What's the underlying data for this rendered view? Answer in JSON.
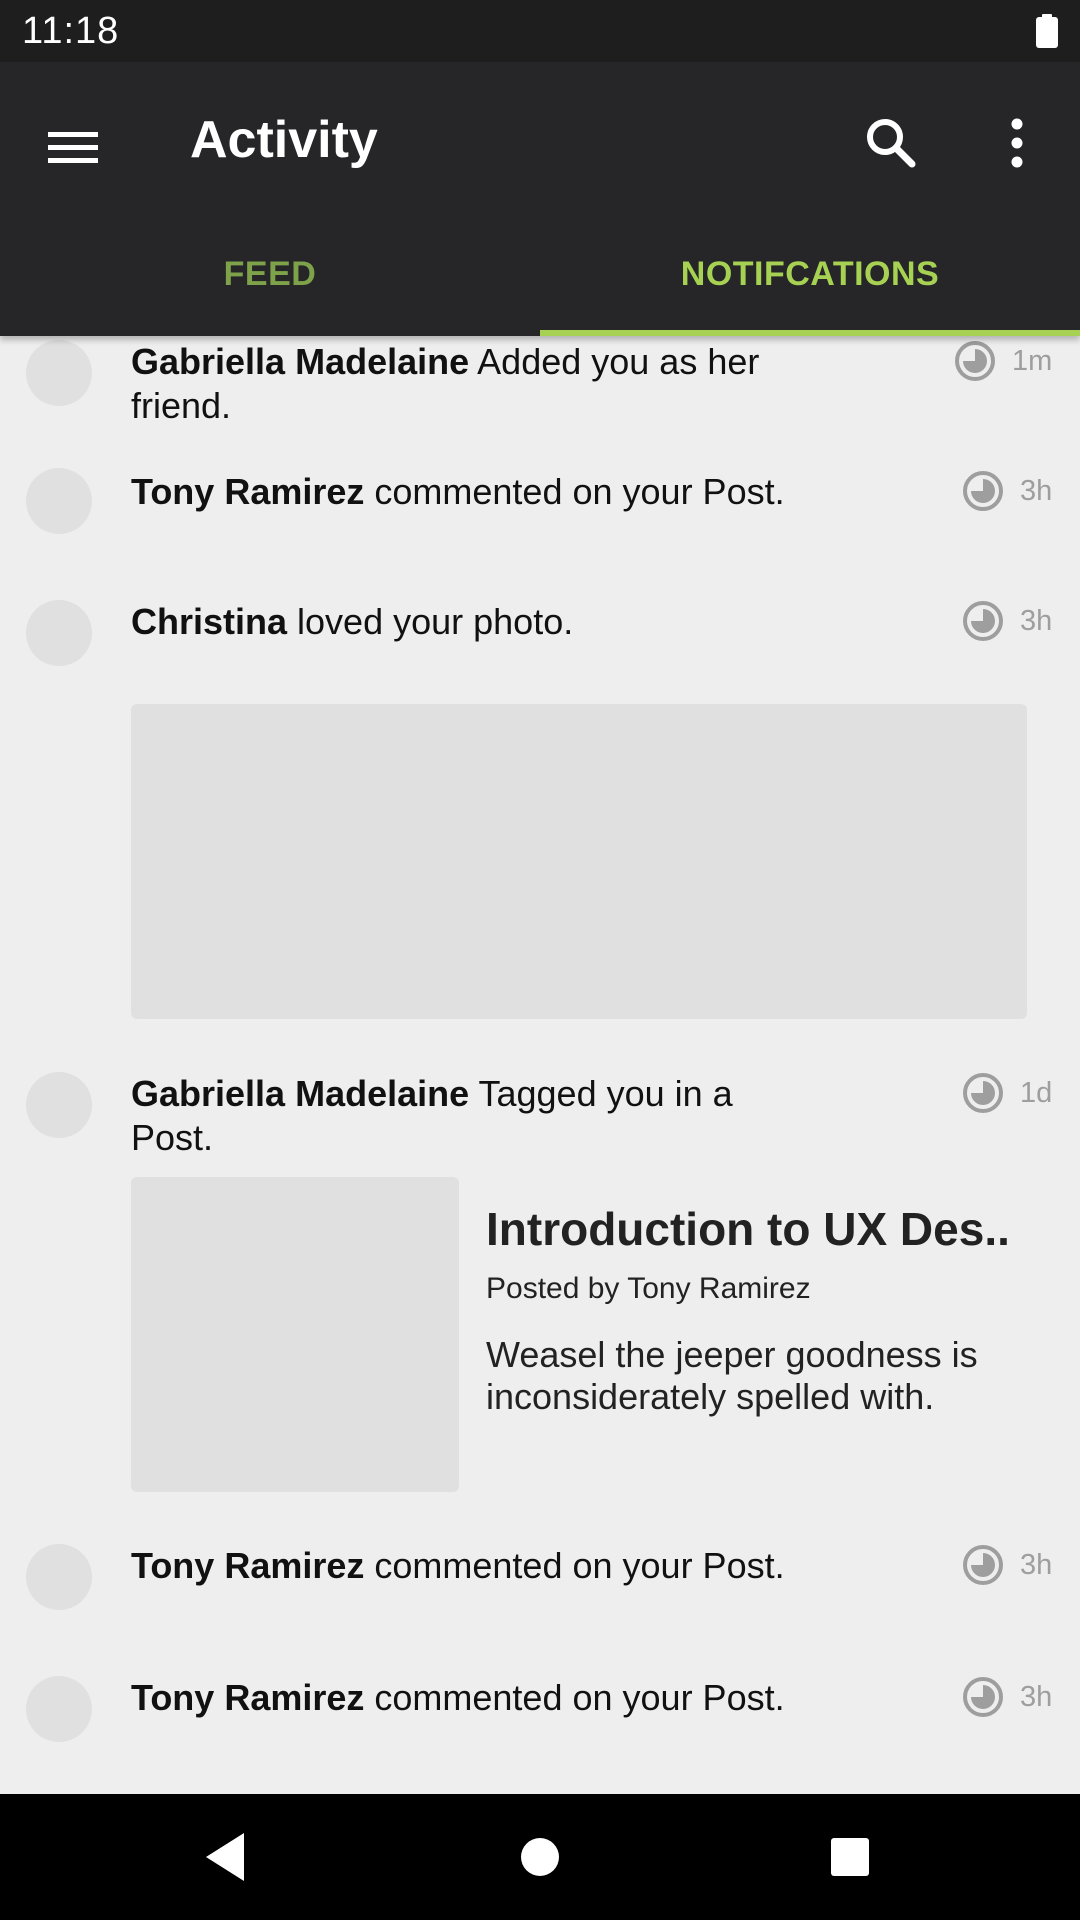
{
  "status_bar": {
    "time": "11:18",
    "battery_icon": "battery-full-icon"
  },
  "app_bar": {
    "title": "Activity",
    "menu_icon": "menu-icon",
    "search_icon": "search-icon",
    "more_icon": "more-vert-icon"
  },
  "tabs": [
    {
      "label": "FEED",
      "selected": false
    },
    {
      "label": "NOTIFCATIONS",
      "selected": true
    }
  ],
  "colors": {
    "accent": "#a7d153",
    "feed_tab": "#7ea24a",
    "app_bar": "#262628",
    "background": "#eeeeee",
    "placeholder": "#e0e0e0",
    "time": "#9e9e9e"
  },
  "notifications": [
    {
      "name": "Gabriella Madelaine",
      "action": " Added you as her",
      "action_line2": "friend.",
      "time": "1m"
    },
    {
      "name": "Tony Ramirez",
      "action": " commented on your Post.",
      "time": "3h"
    },
    {
      "name": "Christina",
      "action": " loved your photo.",
      "time": "3h"
    },
    {
      "name": "Gabriella Madelaine",
      "action": " Tagged you in a",
      "action_line2": "Post.",
      "time": "1d",
      "post": {
        "title": "Introduction to UX Des..",
        "author": "Posted by Tony Ramirez",
        "body": "Weasel the jeeper goodness is inconsiderately spelled with."
      }
    },
    {
      "name": "Tony Ramirez",
      "action": " commented on your Post.",
      "time": "3h"
    },
    {
      "name": "Tony Ramirez",
      "action": " commented on your Post.",
      "time": "3h"
    }
  ],
  "nav": {
    "back_icon": "back-icon",
    "home_icon": "home-icon",
    "recents_icon": "recents-icon"
  }
}
